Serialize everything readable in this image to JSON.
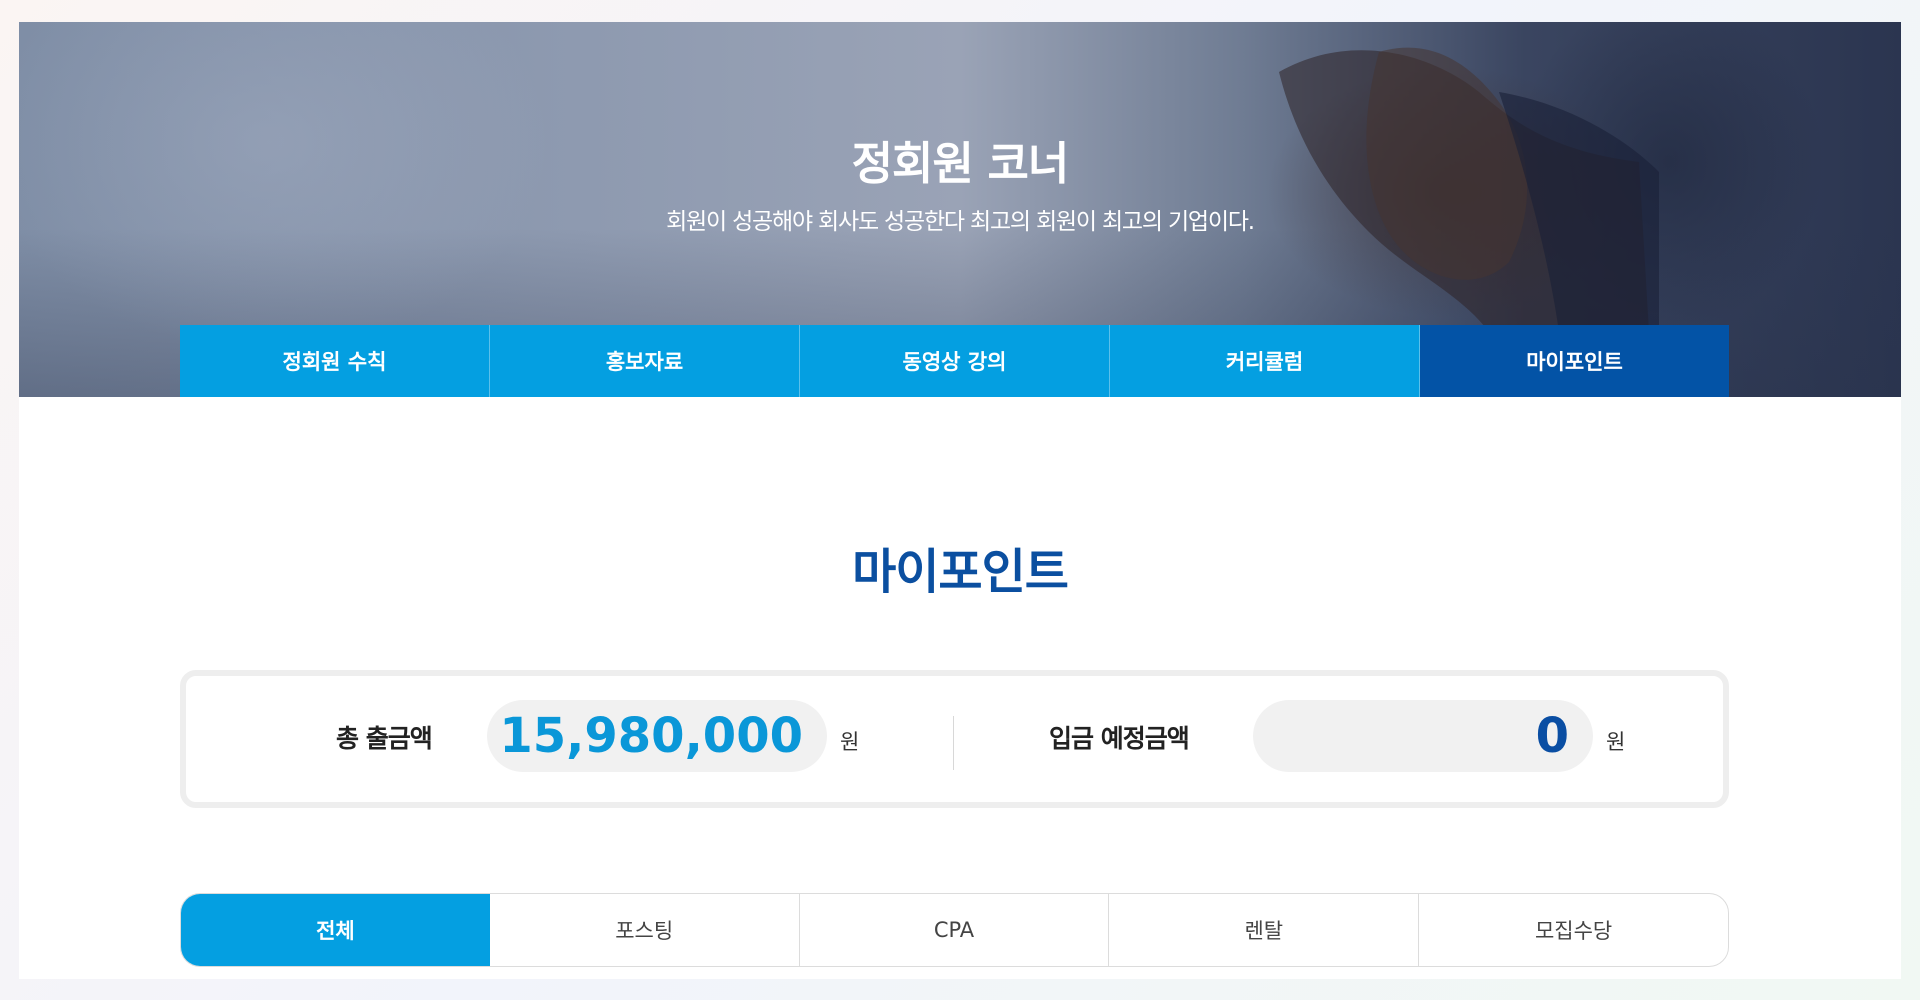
{
  "hero": {
    "title": "정회원 코너",
    "subtitle": "회원이 성공해야 회사도 성공한다 최고의 회원이 최고의 기업이다."
  },
  "nav": {
    "items": [
      {
        "label": "정회원 수칙",
        "active": false
      },
      {
        "label": "홍보자료",
        "active": false
      },
      {
        "label": "동영상 강의",
        "active": false
      },
      {
        "label": "커리큘럼",
        "active": false
      },
      {
        "label": "마이포인트",
        "active": true
      }
    ]
  },
  "section": {
    "title": "마이포인트"
  },
  "summary": {
    "total_label": "총 출금액",
    "total_value": "15,980,000",
    "total_unit": "원",
    "pending_label": "입금 예정금액",
    "pending_value": "0",
    "pending_unit": "원"
  },
  "filters": {
    "items": [
      {
        "label": "전체",
        "active": true
      },
      {
        "label": "포스팅",
        "active": false
      },
      {
        "label": "CPA",
        "active": false
      },
      {
        "label": "렌탈",
        "active": false
      },
      {
        "label": "모집수당",
        "active": false
      }
    ]
  },
  "colors": {
    "primary_blue": "#049fe1",
    "active_nav": "#0353a6",
    "title_blue": "#0b4fa0",
    "total_value_color": "#0a97d8",
    "pending_value_color": "#0a4ea3"
  }
}
